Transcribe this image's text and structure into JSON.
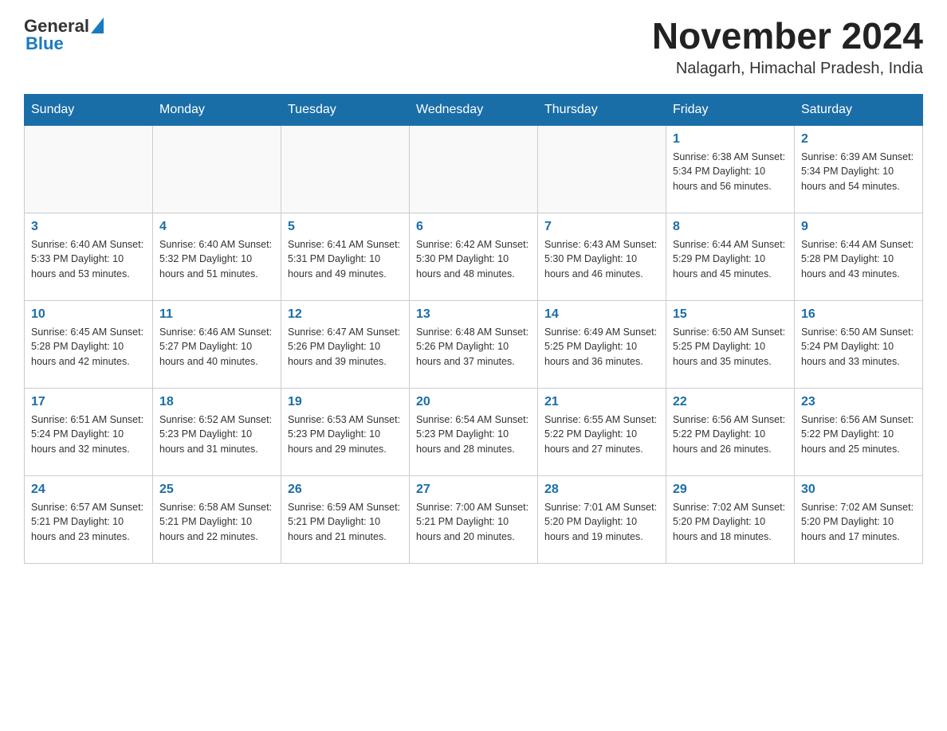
{
  "header": {
    "logo_general": "General",
    "logo_blue": "Blue",
    "month_year": "November 2024",
    "location": "Nalagarh, Himachal Pradesh, India"
  },
  "weekdays": [
    "Sunday",
    "Monday",
    "Tuesday",
    "Wednesday",
    "Thursday",
    "Friday",
    "Saturday"
  ],
  "rows": [
    [
      {
        "day": "",
        "info": ""
      },
      {
        "day": "",
        "info": ""
      },
      {
        "day": "",
        "info": ""
      },
      {
        "day": "",
        "info": ""
      },
      {
        "day": "",
        "info": ""
      },
      {
        "day": "1",
        "info": "Sunrise: 6:38 AM\nSunset: 5:34 PM\nDaylight: 10 hours and 56 minutes."
      },
      {
        "day": "2",
        "info": "Sunrise: 6:39 AM\nSunset: 5:34 PM\nDaylight: 10 hours and 54 minutes."
      }
    ],
    [
      {
        "day": "3",
        "info": "Sunrise: 6:40 AM\nSunset: 5:33 PM\nDaylight: 10 hours and 53 minutes."
      },
      {
        "day": "4",
        "info": "Sunrise: 6:40 AM\nSunset: 5:32 PM\nDaylight: 10 hours and 51 minutes."
      },
      {
        "day": "5",
        "info": "Sunrise: 6:41 AM\nSunset: 5:31 PM\nDaylight: 10 hours and 49 minutes."
      },
      {
        "day": "6",
        "info": "Sunrise: 6:42 AM\nSunset: 5:30 PM\nDaylight: 10 hours and 48 minutes."
      },
      {
        "day": "7",
        "info": "Sunrise: 6:43 AM\nSunset: 5:30 PM\nDaylight: 10 hours and 46 minutes."
      },
      {
        "day": "8",
        "info": "Sunrise: 6:44 AM\nSunset: 5:29 PM\nDaylight: 10 hours and 45 minutes."
      },
      {
        "day": "9",
        "info": "Sunrise: 6:44 AM\nSunset: 5:28 PM\nDaylight: 10 hours and 43 minutes."
      }
    ],
    [
      {
        "day": "10",
        "info": "Sunrise: 6:45 AM\nSunset: 5:28 PM\nDaylight: 10 hours and 42 minutes."
      },
      {
        "day": "11",
        "info": "Sunrise: 6:46 AM\nSunset: 5:27 PM\nDaylight: 10 hours and 40 minutes."
      },
      {
        "day": "12",
        "info": "Sunrise: 6:47 AM\nSunset: 5:26 PM\nDaylight: 10 hours and 39 minutes."
      },
      {
        "day": "13",
        "info": "Sunrise: 6:48 AM\nSunset: 5:26 PM\nDaylight: 10 hours and 37 minutes."
      },
      {
        "day": "14",
        "info": "Sunrise: 6:49 AM\nSunset: 5:25 PM\nDaylight: 10 hours and 36 minutes."
      },
      {
        "day": "15",
        "info": "Sunrise: 6:50 AM\nSunset: 5:25 PM\nDaylight: 10 hours and 35 minutes."
      },
      {
        "day": "16",
        "info": "Sunrise: 6:50 AM\nSunset: 5:24 PM\nDaylight: 10 hours and 33 minutes."
      }
    ],
    [
      {
        "day": "17",
        "info": "Sunrise: 6:51 AM\nSunset: 5:24 PM\nDaylight: 10 hours and 32 minutes."
      },
      {
        "day": "18",
        "info": "Sunrise: 6:52 AM\nSunset: 5:23 PM\nDaylight: 10 hours and 31 minutes."
      },
      {
        "day": "19",
        "info": "Sunrise: 6:53 AM\nSunset: 5:23 PM\nDaylight: 10 hours and 29 minutes."
      },
      {
        "day": "20",
        "info": "Sunrise: 6:54 AM\nSunset: 5:23 PM\nDaylight: 10 hours and 28 minutes."
      },
      {
        "day": "21",
        "info": "Sunrise: 6:55 AM\nSunset: 5:22 PM\nDaylight: 10 hours and 27 minutes."
      },
      {
        "day": "22",
        "info": "Sunrise: 6:56 AM\nSunset: 5:22 PM\nDaylight: 10 hours and 26 minutes."
      },
      {
        "day": "23",
        "info": "Sunrise: 6:56 AM\nSunset: 5:22 PM\nDaylight: 10 hours and 25 minutes."
      }
    ],
    [
      {
        "day": "24",
        "info": "Sunrise: 6:57 AM\nSunset: 5:21 PM\nDaylight: 10 hours and 23 minutes."
      },
      {
        "day": "25",
        "info": "Sunrise: 6:58 AM\nSunset: 5:21 PM\nDaylight: 10 hours and 22 minutes."
      },
      {
        "day": "26",
        "info": "Sunrise: 6:59 AM\nSunset: 5:21 PM\nDaylight: 10 hours and 21 minutes."
      },
      {
        "day": "27",
        "info": "Sunrise: 7:00 AM\nSunset: 5:21 PM\nDaylight: 10 hours and 20 minutes."
      },
      {
        "day": "28",
        "info": "Sunrise: 7:01 AM\nSunset: 5:20 PM\nDaylight: 10 hours and 19 minutes."
      },
      {
        "day": "29",
        "info": "Sunrise: 7:02 AM\nSunset: 5:20 PM\nDaylight: 10 hours and 18 minutes."
      },
      {
        "day": "30",
        "info": "Sunrise: 7:02 AM\nSunset: 5:20 PM\nDaylight: 10 hours and 17 minutes."
      }
    ]
  ]
}
